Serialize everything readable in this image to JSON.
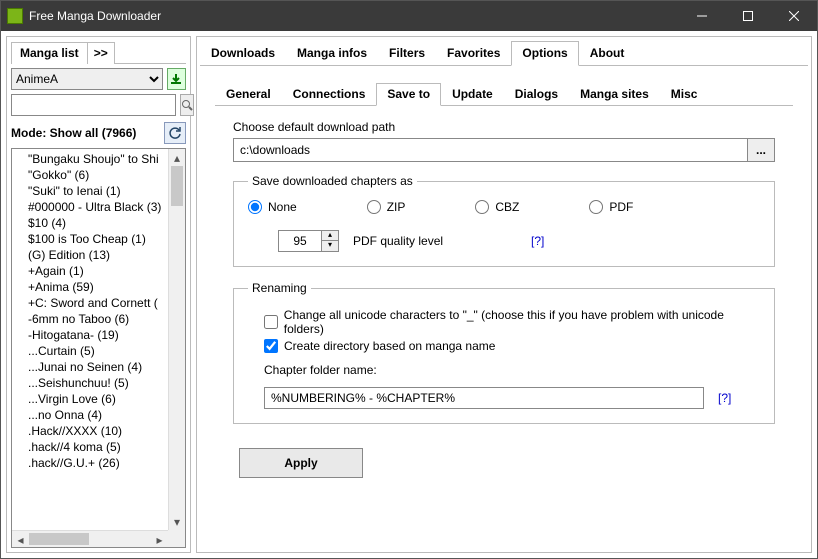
{
  "window": {
    "title": "Free Manga Downloader"
  },
  "sidebar": {
    "tab_label": "Manga list",
    "tab_overflow": ">>",
    "source_selected": "AnimeA",
    "search_value": "",
    "mode_prefix": "Mode:",
    "mode_value": "Show all",
    "mode_count": "7966",
    "items": [
      "\"Bungaku Shoujo\" to Shi",
      "\"Gokko\" (6)",
      "\"Suki\" to Ienai (1)",
      "#000000 - Ultra Black (3)",
      "$10 (4)",
      "$100 is Too Cheap (1)",
      "(G) Edition (13)",
      "+Again (1)",
      "+Anima (59)",
      "+C: Sword and Cornett (",
      "-6mm no Taboo (6)",
      "-Hitogatana- (19)",
      "...Curtain (5)",
      "...Junai no Seinen (4)",
      "...Seishunchuu! (5)",
      "...Virgin Love (6)",
      "...no Onna (4)",
      ".Hack//XXXX (10)",
      ".hack//4 koma (5)",
      ".hack//G.U.+ (26)"
    ]
  },
  "main_tabs": [
    {
      "label": "Downloads",
      "active": false
    },
    {
      "label": "Manga infos",
      "active": false
    },
    {
      "label": "Filters",
      "active": false
    },
    {
      "label": "Favorites",
      "active": false
    },
    {
      "label": "Options",
      "active": true
    },
    {
      "label": "About",
      "active": false
    }
  ],
  "options": {
    "sub_tabs": [
      {
        "label": "General",
        "active": false
      },
      {
        "label": "Connections",
        "active": false
      },
      {
        "label": "Save to",
        "active": true
      },
      {
        "label": "Update",
        "active": false
      },
      {
        "label": "Dialogs",
        "active": false
      },
      {
        "label": "Manga sites",
        "active": false
      },
      {
        "label": "Misc",
        "active": false
      }
    ],
    "save_to": {
      "path_label": "Choose default download path",
      "path_value": "c:\\downloads",
      "browse_label": "...",
      "save_as_legend": "Save downloaded chapters as",
      "save_as_options": [
        {
          "label": "None",
          "checked": true
        },
        {
          "label": "ZIP",
          "checked": false
        },
        {
          "label": "CBZ",
          "checked": false
        },
        {
          "label": "PDF",
          "checked": false
        }
      ],
      "pdf_quality": "95",
      "pdf_quality_label": "PDF quality level",
      "help_symbol": "[?]",
      "renaming_legend": "Renaming",
      "check_unicode": "Change all unicode characters to \"_\" (choose this if you have problem with unicode folders)",
      "check_unicode_checked": false,
      "check_createdir": "Create directory based on manga name",
      "check_createdir_checked": true,
      "chapter_folder_label": "Chapter folder name:",
      "chapter_folder_value": "%NUMBERING% - %CHAPTER%"
    },
    "apply_label": "Apply"
  }
}
